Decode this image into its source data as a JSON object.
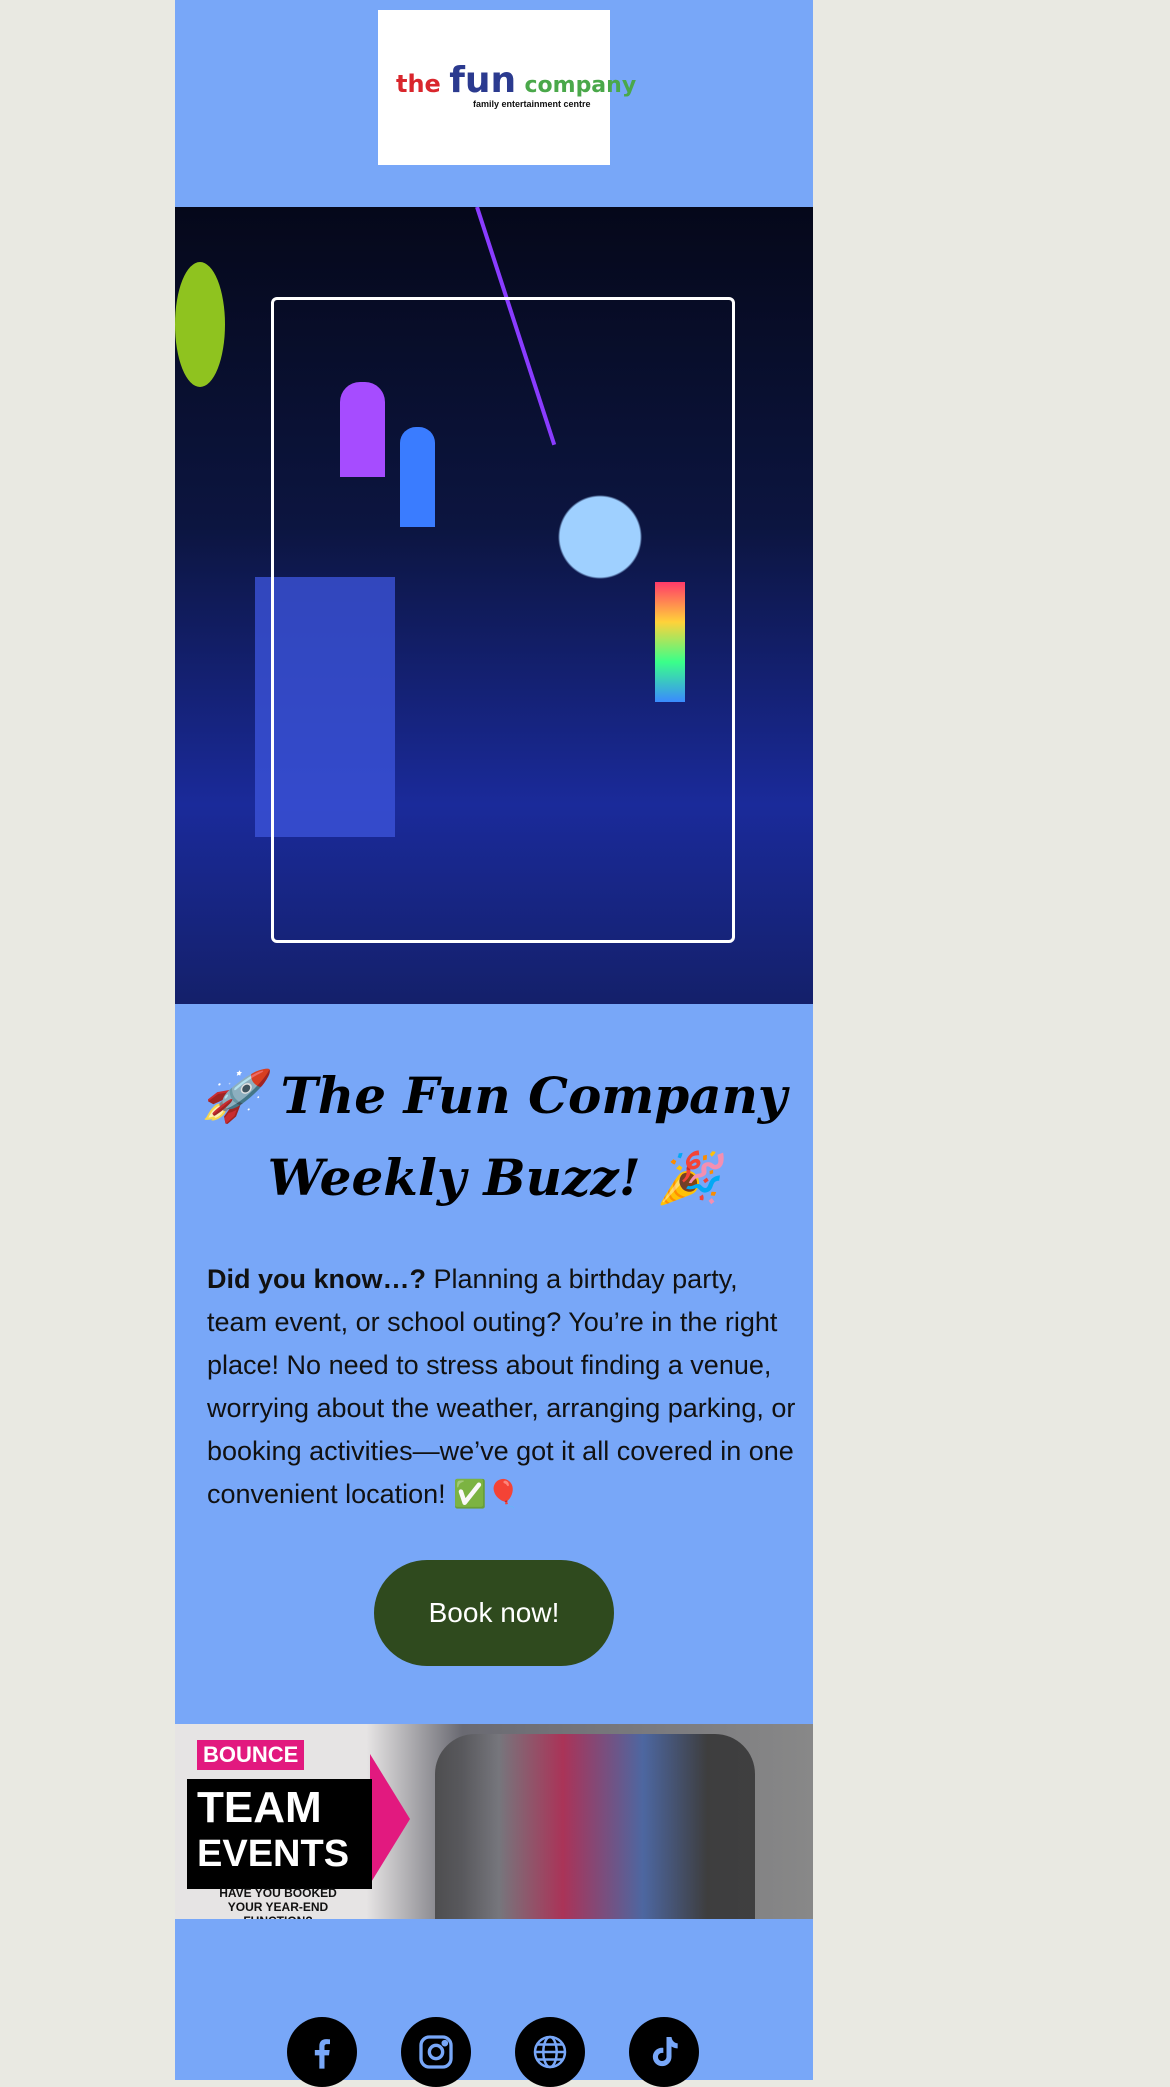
{
  "logo": {
    "brand_words": [
      "the",
      "fun",
      "company"
    ],
    "tagline": "family entertainment centre"
  },
  "hero": {
    "alt": "arcade interior"
  },
  "headline": {
    "line1": "🚀 The Fun Company",
    "line2": "Weekly Buzz! 🎉"
  },
  "body": {
    "lead": "Did you know…?",
    "text": " Planning a birthday party, team event, or school outing? You’re in the right place! No need to stress about finding a venue, worrying about the weather, arranging parking, or booking activities—we’ve got it all covered in one convenient location! ✅🎈"
  },
  "cta": {
    "label": "Book now!"
  },
  "banner": {
    "brand": "BOUNCE",
    "title_line1": "TEAM",
    "title_line2": "EVENTS",
    "question": "HAVE YOU BOOKED YOUR YEAR-END FUNCTION?"
  },
  "social": [
    "facebook-icon",
    "instagram-icon",
    "globe-icon",
    "tiktok-icon"
  ],
  "colors": {
    "background": "#78a7f8",
    "button": "#2f4a1e",
    "page": "#e9e9e2"
  }
}
